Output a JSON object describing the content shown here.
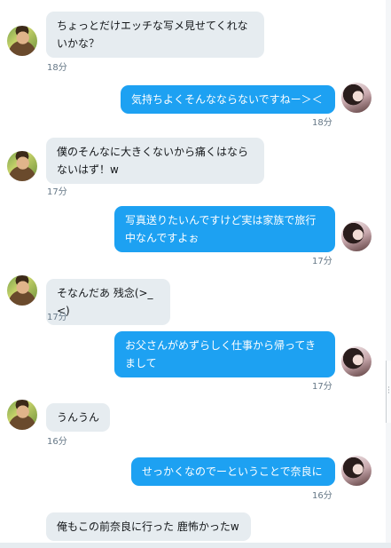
{
  "messages": [
    {
      "side": "in",
      "text": "ちょっとだけエッチな写メ見せてくれないかな？",
      "time": "18分",
      "avatar_icon": "man-avatar"
    },
    {
      "side": "out",
      "text": "気持ちよくそんなならないですねー＞＜",
      "time": "18分",
      "avatar_icon": "woman-avatar"
    },
    {
      "side": "in",
      "text": "僕のそんなに大きくないから痛くはならないはず！w",
      "time": "17分",
      "avatar_icon": "man-avatar"
    },
    {
      "side": "out",
      "text": "写真送りたいんですけど実は家族で旅行中なんですよぉ",
      "time": "17分",
      "avatar_icon": "woman-avatar"
    },
    {
      "side": "in",
      "text": "そなんだあ 残念(>_<)",
      "time": "17分",
      "avatar_icon": "man-avatar"
    },
    {
      "side": "out",
      "text": "お父さんがめずらしく仕事から帰ってきまして",
      "time": "17分",
      "avatar_icon": "woman-avatar"
    },
    {
      "side": "in",
      "text": "うんうん",
      "time": "16分",
      "avatar_icon": "man-avatar"
    },
    {
      "side": "out",
      "text": "せっかくなのでーということで奈良に",
      "time": "16分",
      "avatar_icon": "woman-avatar"
    },
    {
      "side": "in",
      "text": "俺もこの前奈良に行った 鹿怖かったw",
      "time": "",
      "avatar_icon": "man-avatar"
    }
  ],
  "colors": {
    "incoming_bubble": "#e6ecf0",
    "outgoing_bubble": "#1da1f2",
    "timestamp": "#657786"
  }
}
